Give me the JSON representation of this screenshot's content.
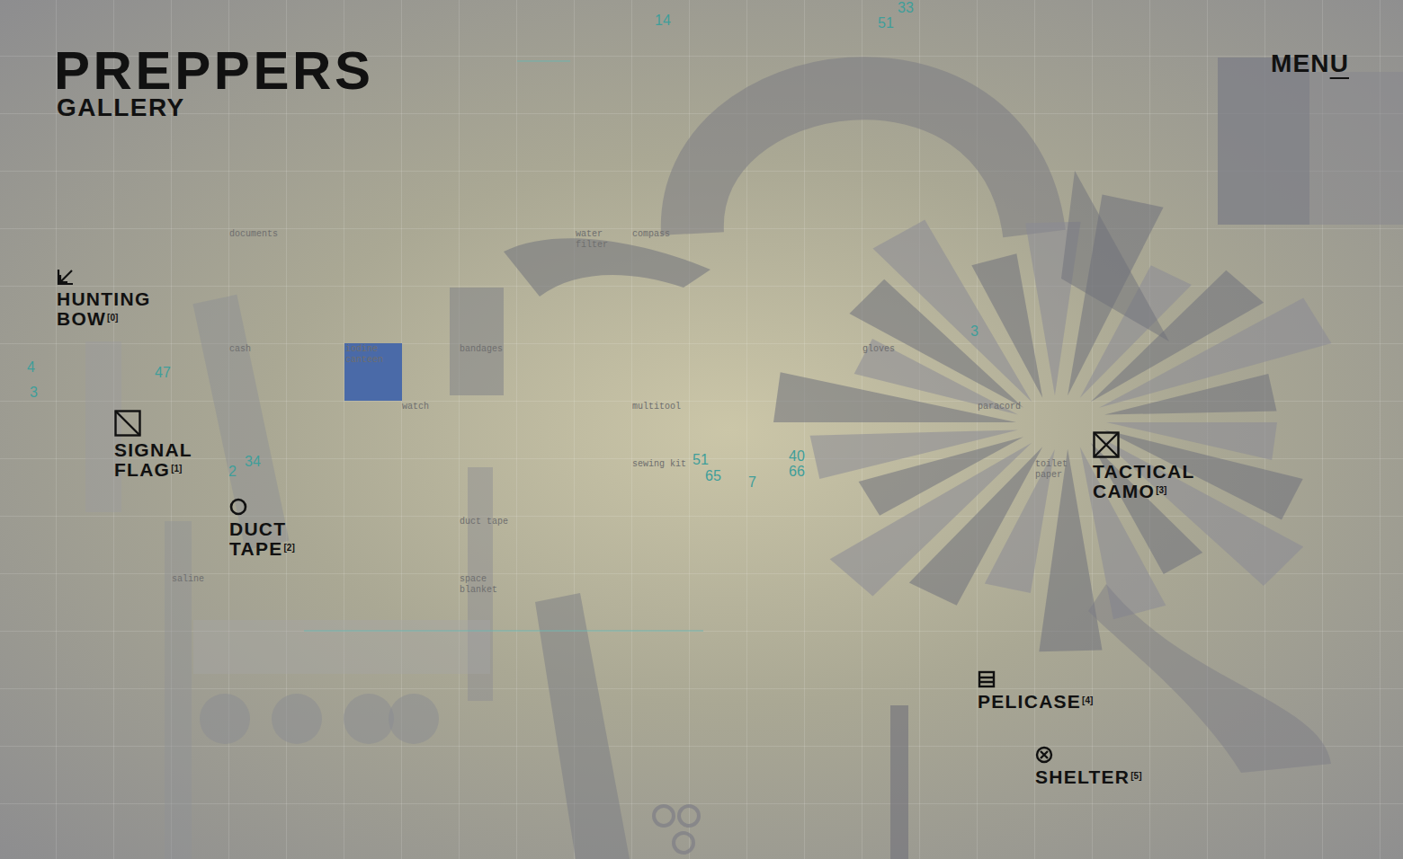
{
  "header": {
    "title": "PREPPERS",
    "subtitle": "GALLERY",
    "menu": {
      "text": "MEN",
      "underlined": "U"
    }
  },
  "hotspots": [
    {
      "lines": [
        "HUNTING",
        "BOW"
      ],
      "index": "[0]",
      "kind": "arrow"
    },
    {
      "lines": [
        "SIGNAL",
        "FLAG"
      ],
      "index": "[1]",
      "kind": "slash"
    },
    {
      "lines": [
        "DUCT",
        "TAPE"
      ],
      "index": "[2]",
      "kind": "circle"
    },
    {
      "lines": [
        "TACTICAL",
        "CAMO"
      ],
      "index": "[3]",
      "kind": "cross"
    },
    {
      "lines": [
        "PELICASE"
      ],
      "index": "[4]",
      "kind": "case"
    },
    {
      "lines": [
        "SHELTER"
      ],
      "index": "[5]",
      "kind": "circlecross"
    }
  ],
  "scene_labels": [
    "documents",
    "water filter",
    "compass",
    "cash",
    "iodine canteen",
    "bandages",
    "gloves",
    "watch",
    "multitool",
    "paracord",
    "sewing kit",
    "toilet paper",
    "duct tape",
    "saline",
    "space blanket"
  ],
  "scene_numbers": [
    "14",
    "33",
    "51",
    "4",
    "3",
    "47",
    "2",
    "34",
    "51",
    "65",
    "7",
    "40",
    "66",
    "3"
  ]
}
